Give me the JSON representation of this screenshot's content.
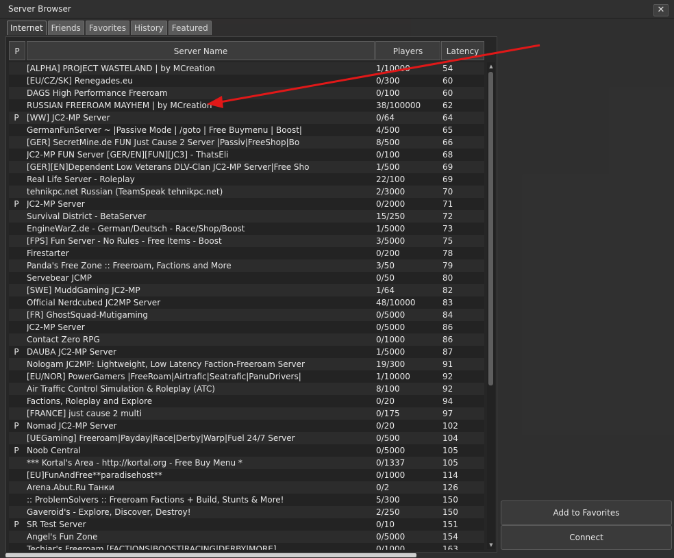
{
  "window": {
    "title": "Server Browser",
    "close_glyph": "✕"
  },
  "tabs": [
    "Internet",
    "Friends",
    "Favorites",
    "History",
    "Featured"
  ],
  "columns": {
    "p": "P",
    "name": "Server Name",
    "players": "Players",
    "latency": "Latency"
  },
  "servers": [
    {
      "p": "",
      "name": "[ALPHA] PROJECT WASTELAND | by MCreation",
      "players": "1/10000",
      "latency": "54"
    },
    {
      "p": "",
      "name": "[EU/CZ/SK] Renegades.eu",
      "players": "0/300",
      "latency": "60"
    },
    {
      "p": "",
      "name": "DAGS High Performance Freeroam",
      "players": "0/100",
      "latency": "60"
    },
    {
      "p": "",
      "name": "RUSSIAN FREEROAM MAYHEM | by MCreation",
      "players": "38/100000",
      "latency": "62"
    },
    {
      "p": "P",
      "name": "[WW] JC2-MP Server",
      "players": "0/64",
      "latency": "64"
    },
    {
      "p": "",
      "name": "GermanFunServer ~ |Passive Mode | /goto | Free Buymenu | Boost|",
      "players": "4/500",
      "latency": "65"
    },
    {
      "p": "",
      "name": "[GER] SecretMine.de FUN Just Cause 2 Server |Passiv|FreeShop|Bo",
      "players": "8/500",
      "latency": "66"
    },
    {
      "p": "",
      "name": "JC2-MP FUN Server [GER/EN][FUN][JC3] - ThatsEli",
      "players": "0/100",
      "latency": "68"
    },
    {
      "p": "",
      "name": "[GER][EN]Dependent Low Veterans DLV-Clan JC2-MP Server|Free Sho",
      "players": "1/500",
      "latency": "69"
    },
    {
      "p": "",
      "name": "Real Life Server - Roleplay",
      "players": "22/100",
      "latency": "69"
    },
    {
      "p": "",
      "name": "tehnikpc.net Russian (TeamSpeak tehnikpc.net)",
      "players": "2/3000",
      "latency": "70"
    },
    {
      "p": "P",
      "name": "JC2-MP Server",
      "players": "0/2000",
      "latency": "71"
    },
    {
      "p": "",
      "name": "Survival District - BetaServer",
      "players": "15/250",
      "latency": "72"
    },
    {
      "p": "",
      "name": "EngineWarZ.de - German/Deutsch - Race/Shop/Boost",
      "players": "1/5000",
      "latency": "73"
    },
    {
      "p": "",
      "name": "[FPS] Fun Server - No Rules - Free Items - Boost",
      "players": "3/5000",
      "latency": "75"
    },
    {
      "p": "",
      "name": "Firestarter",
      "players": "0/200",
      "latency": "78"
    },
    {
      "p": "",
      "name": "Panda's Free Zone :: Freeroam, Factions and More",
      "players": "3/50",
      "latency": "79"
    },
    {
      "p": "",
      "name": "Servebear JCMP",
      "players": "0/50",
      "latency": "80"
    },
    {
      "p": "",
      "name": "[SWE] MuddGaming JC2-MP",
      "players": "1/64",
      "latency": "82"
    },
    {
      "p": "",
      "name": "Official Nerdcubed JC2MP Server",
      "players": "48/10000",
      "latency": "83"
    },
    {
      "p": "",
      "name": "[FR] GhostSquad-Mutigaming",
      "players": "0/5000",
      "latency": "84"
    },
    {
      "p": "",
      "name": "JC2-MP Server",
      "players": "0/5000",
      "latency": "86"
    },
    {
      "p": "",
      "name": "Contact Zero RPG",
      "players": "0/1000",
      "latency": "86"
    },
    {
      "p": "P",
      "name": "DAUBA JC2-MP Server",
      "players": "1/5000",
      "latency": "87"
    },
    {
      "p": "",
      "name": "Nologam JC2MP: Lightweight, Low Latency Faction-Freeroam Server",
      "players": "19/300",
      "latency": "91"
    },
    {
      "p": "",
      "name": "[EU/NOR] PowerGamers |FreeRoam|Airtrafic|Seatrafic|PanuDrivers|",
      "players": "1/10000",
      "latency": "92"
    },
    {
      "p": "",
      "name": "Air Traffic Control Simulation & Roleplay (ATC)",
      "players": "8/100",
      "latency": "92"
    },
    {
      "p": "",
      "name": "Factions, Roleplay and Explore",
      "players": "0/20",
      "latency": "94"
    },
    {
      "p": "",
      "name": "[FRANCE] just cause 2 multi",
      "players": "0/175",
      "latency": "97"
    },
    {
      "p": "P",
      "name": "Nomad JC2-MP Server",
      "players": "0/20",
      "latency": "102"
    },
    {
      "p": "",
      "name": "[UEGaming] Freeroam|Payday|Race|Derby|Warp|Fuel 24/7 Server",
      "players": "0/500",
      "latency": "104"
    },
    {
      "p": "P",
      "name": "Noob Central",
      "players": "0/5000",
      "latency": "105"
    },
    {
      "p": "",
      "name": "*** Kortal's Area - http://kortal.org - Free Buy Menu *",
      "players": "0/1337",
      "latency": "105"
    },
    {
      "p": "",
      "name": "[EU]FunAndFree**paradisehost**",
      "players": "0/1000",
      "latency": "114"
    },
    {
      "p": "",
      "name": "Arena.Abut.Ru Танки",
      "players": "0/2",
      "latency": "126"
    },
    {
      "p": "",
      "name": ":: ProblemSolvers :: Freeroam Factions + Build, Stunts & More!",
      "players": "5/300",
      "latency": "150"
    },
    {
      "p": "",
      "name": "Gaveroid's - Explore, Discover, Destroy!",
      "players": "2/250",
      "latency": "150"
    },
    {
      "p": "P",
      "name": "SR Test Server",
      "players": "0/10",
      "latency": "151"
    },
    {
      "p": "",
      "name": "Angel's Fun Zone",
      "players": "0/5000",
      "latency": "154"
    },
    {
      "p": "",
      "name": "Techiar's Freeroam [FACTIONS|BOOST|RACING|DERBY|MORE]",
      "players": "0/1000",
      "latency": "163"
    }
  ],
  "buttons": {
    "add_favorites": "Add to Favorites",
    "connect": "Connect"
  },
  "colors": {
    "annotation_arrow": "#e01818"
  }
}
